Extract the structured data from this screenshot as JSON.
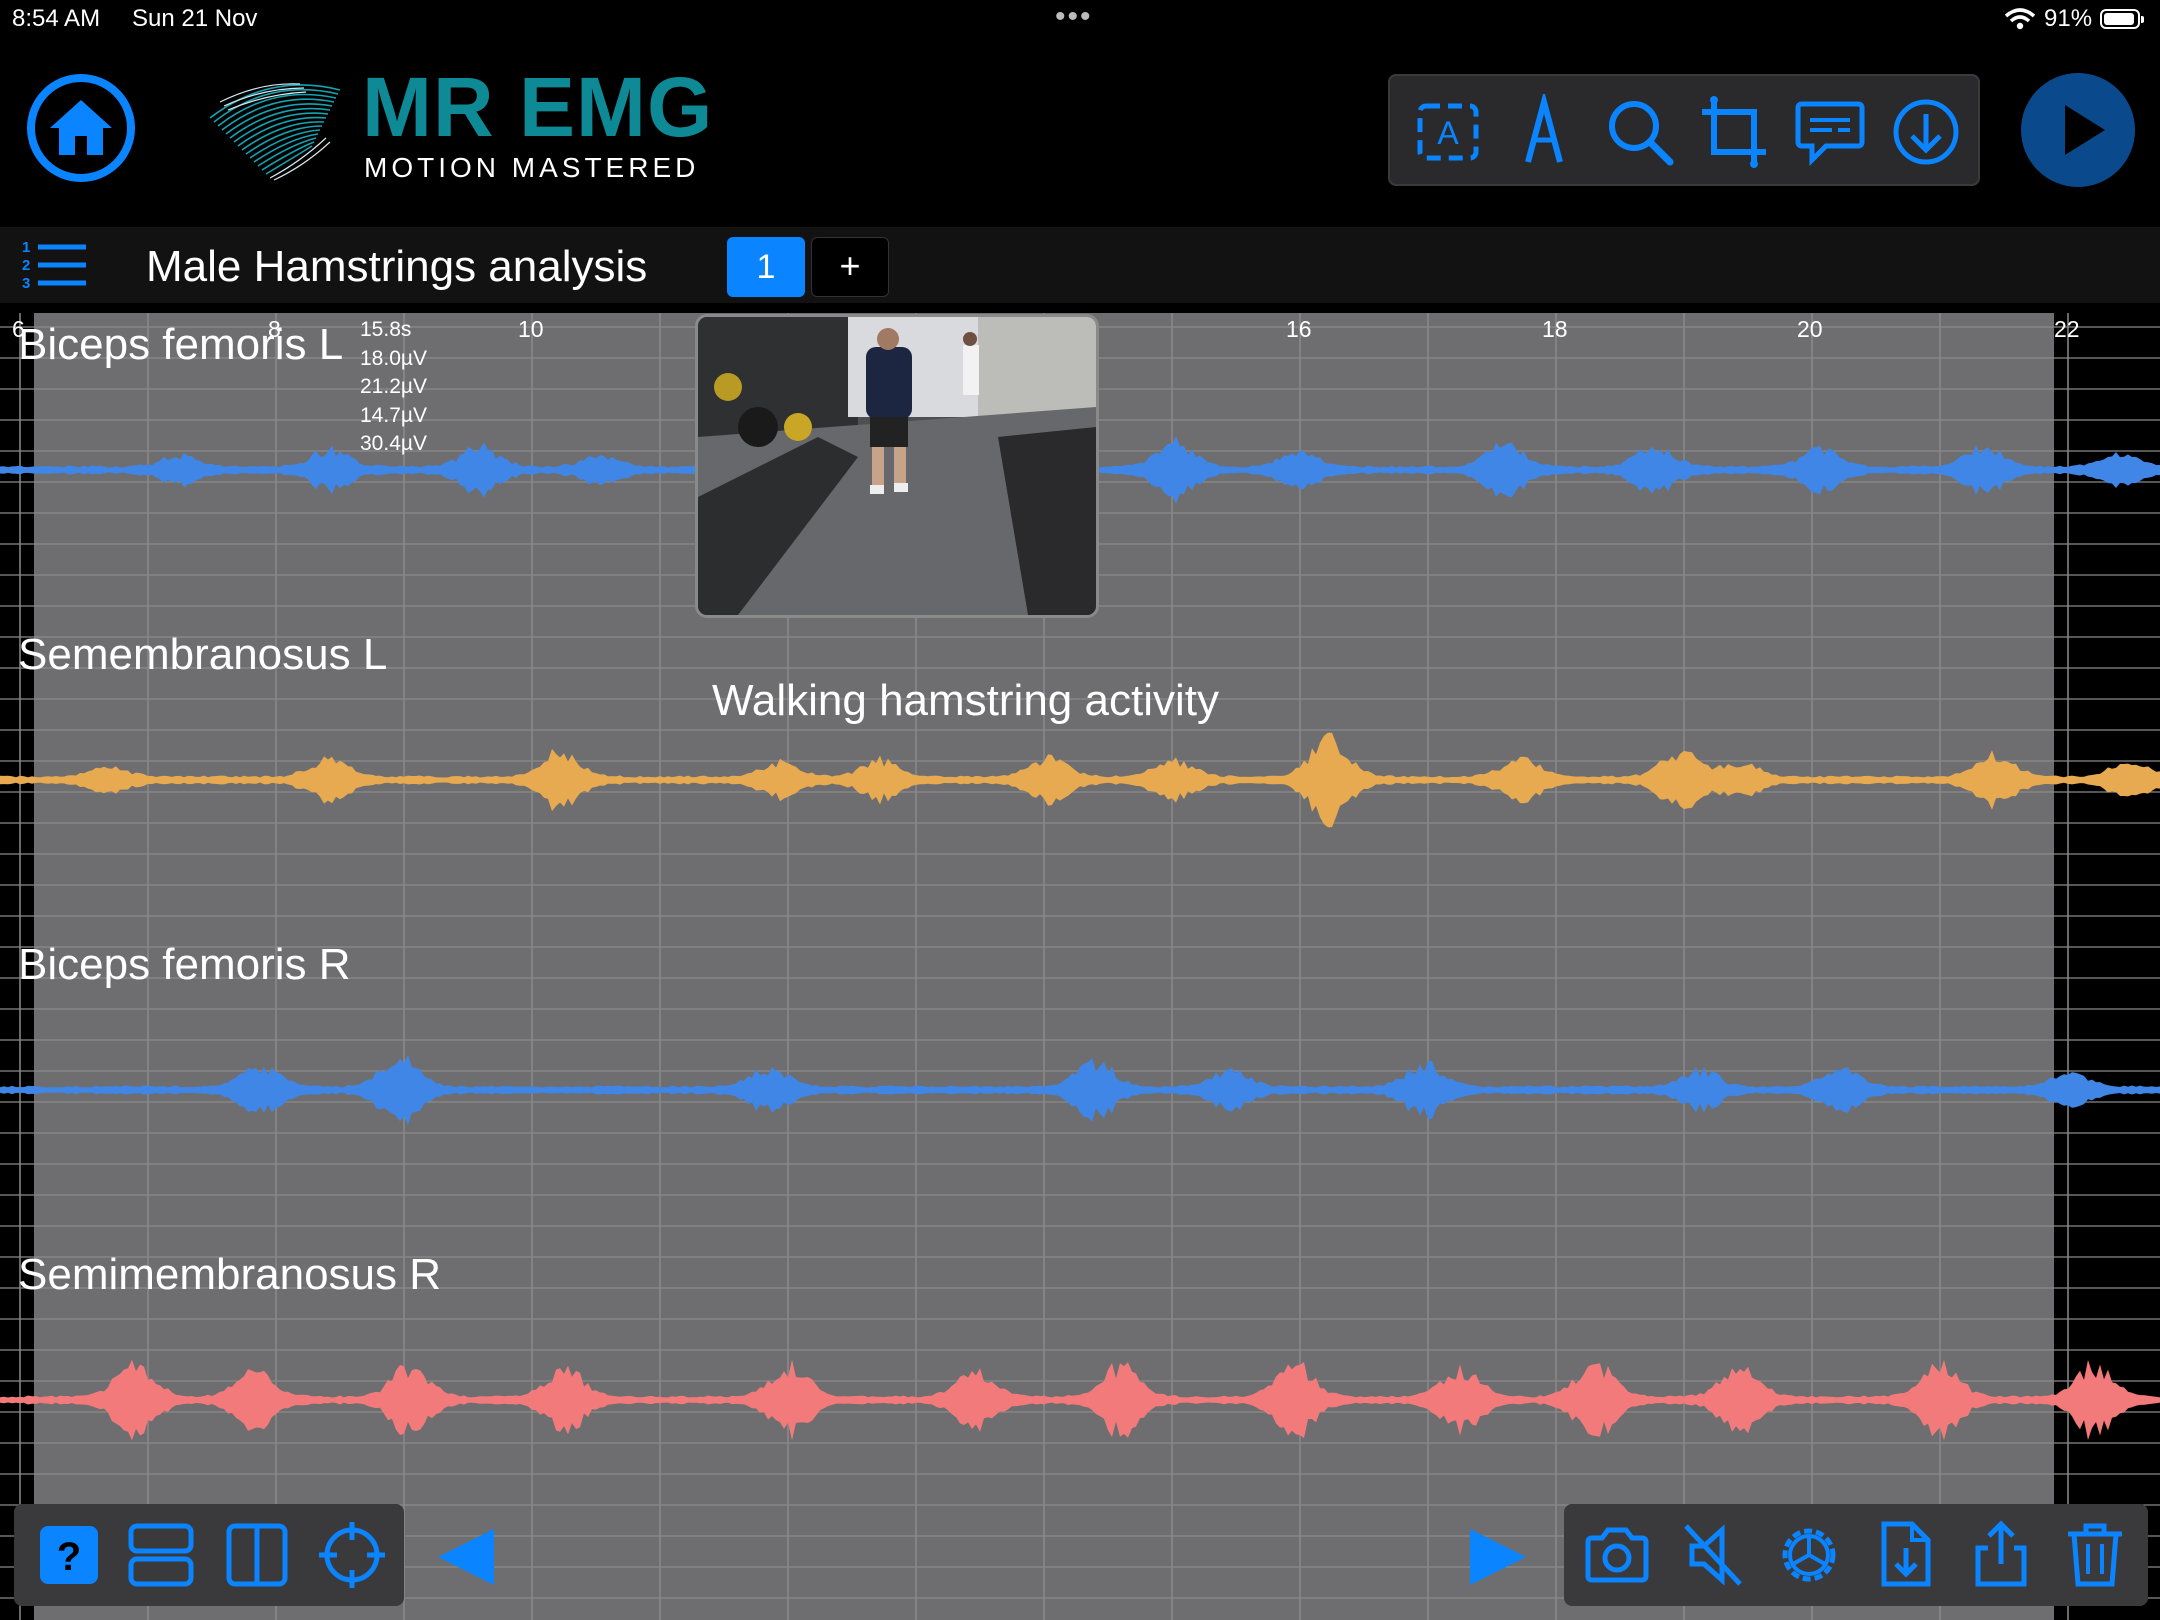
{
  "status_bar": {
    "time": "8:54 AM",
    "date": "Sun 21 Nov",
    "dots": "•••",
    "battery": "91%"
  },
  "brand": {
    "title": "MR EMG",
    "subtitle": "MOTION MASTERED",
    "title_color": "#0e8a96"
  },
  "icons": {
    "home": "home-icon",
    "text_tool": "text-box-icon",
    "pen_tool": "pen-icon",
    "zoom_tool": "magnifier-icon",
    "crop_tool": "crop-icon",
    "comment_tool": "comment-icon",
    "download_tool": "download-icon",
    "play": "play-icon",
    "list": "numbered-list-icon",
    "help": "help-icon",
    "layout_rows": "rows-layout-icon",
    "layout_columns": "columns-layout-icon",
    "target": "crosshair-icon",
    "prev": "triangle-left-icon",
    "next": "triangle-right-icon",
    "camera": "camera-icon",
    "mute": "speaker-muted-icon",
    "settings": "gear-icon",
    "import": "file-import-icon",
    "share": "share-icon",
    "delete": "trash-icon"
  },
  "session": {
    "title": "Male Hamstrings analysis",
    "tabs": [
      "1",
      "+"
    ]
  },
  "axis": {
    "ticks": [
      "6",
      "8",
      "10",
      "16",
      "18",
      "20",
      "22"
    ]
  },
  "readout": {
    "time": "15.8s",
    "values": [
      "18.0µV",
      "21.2µV",
      "14.7µV",
      "30.4µV"
    ]
  },
  "annotation": "Walking hamstring activity",
  "channels": [
    {
      "label": "Biceps femoris L",
      "color": "#3f86e6"
    },
    {
      "label": "Semembranosus L",
      "color": "#e8aa50"
    },
    {
      "label": "Biceps femoris R",
      "color": "#3f86e6"
    },
    {
      "label": "Semimembranosus R",
      "color": "#f27a7a"
    }
  ],
  "colors": {
    "accent": "#0a84ff",
    "plot_bg": "#6e6e70",
    "grid": "#8a8a8a",
    "toolbar_bg": "#2a2a2c"
  }
}
